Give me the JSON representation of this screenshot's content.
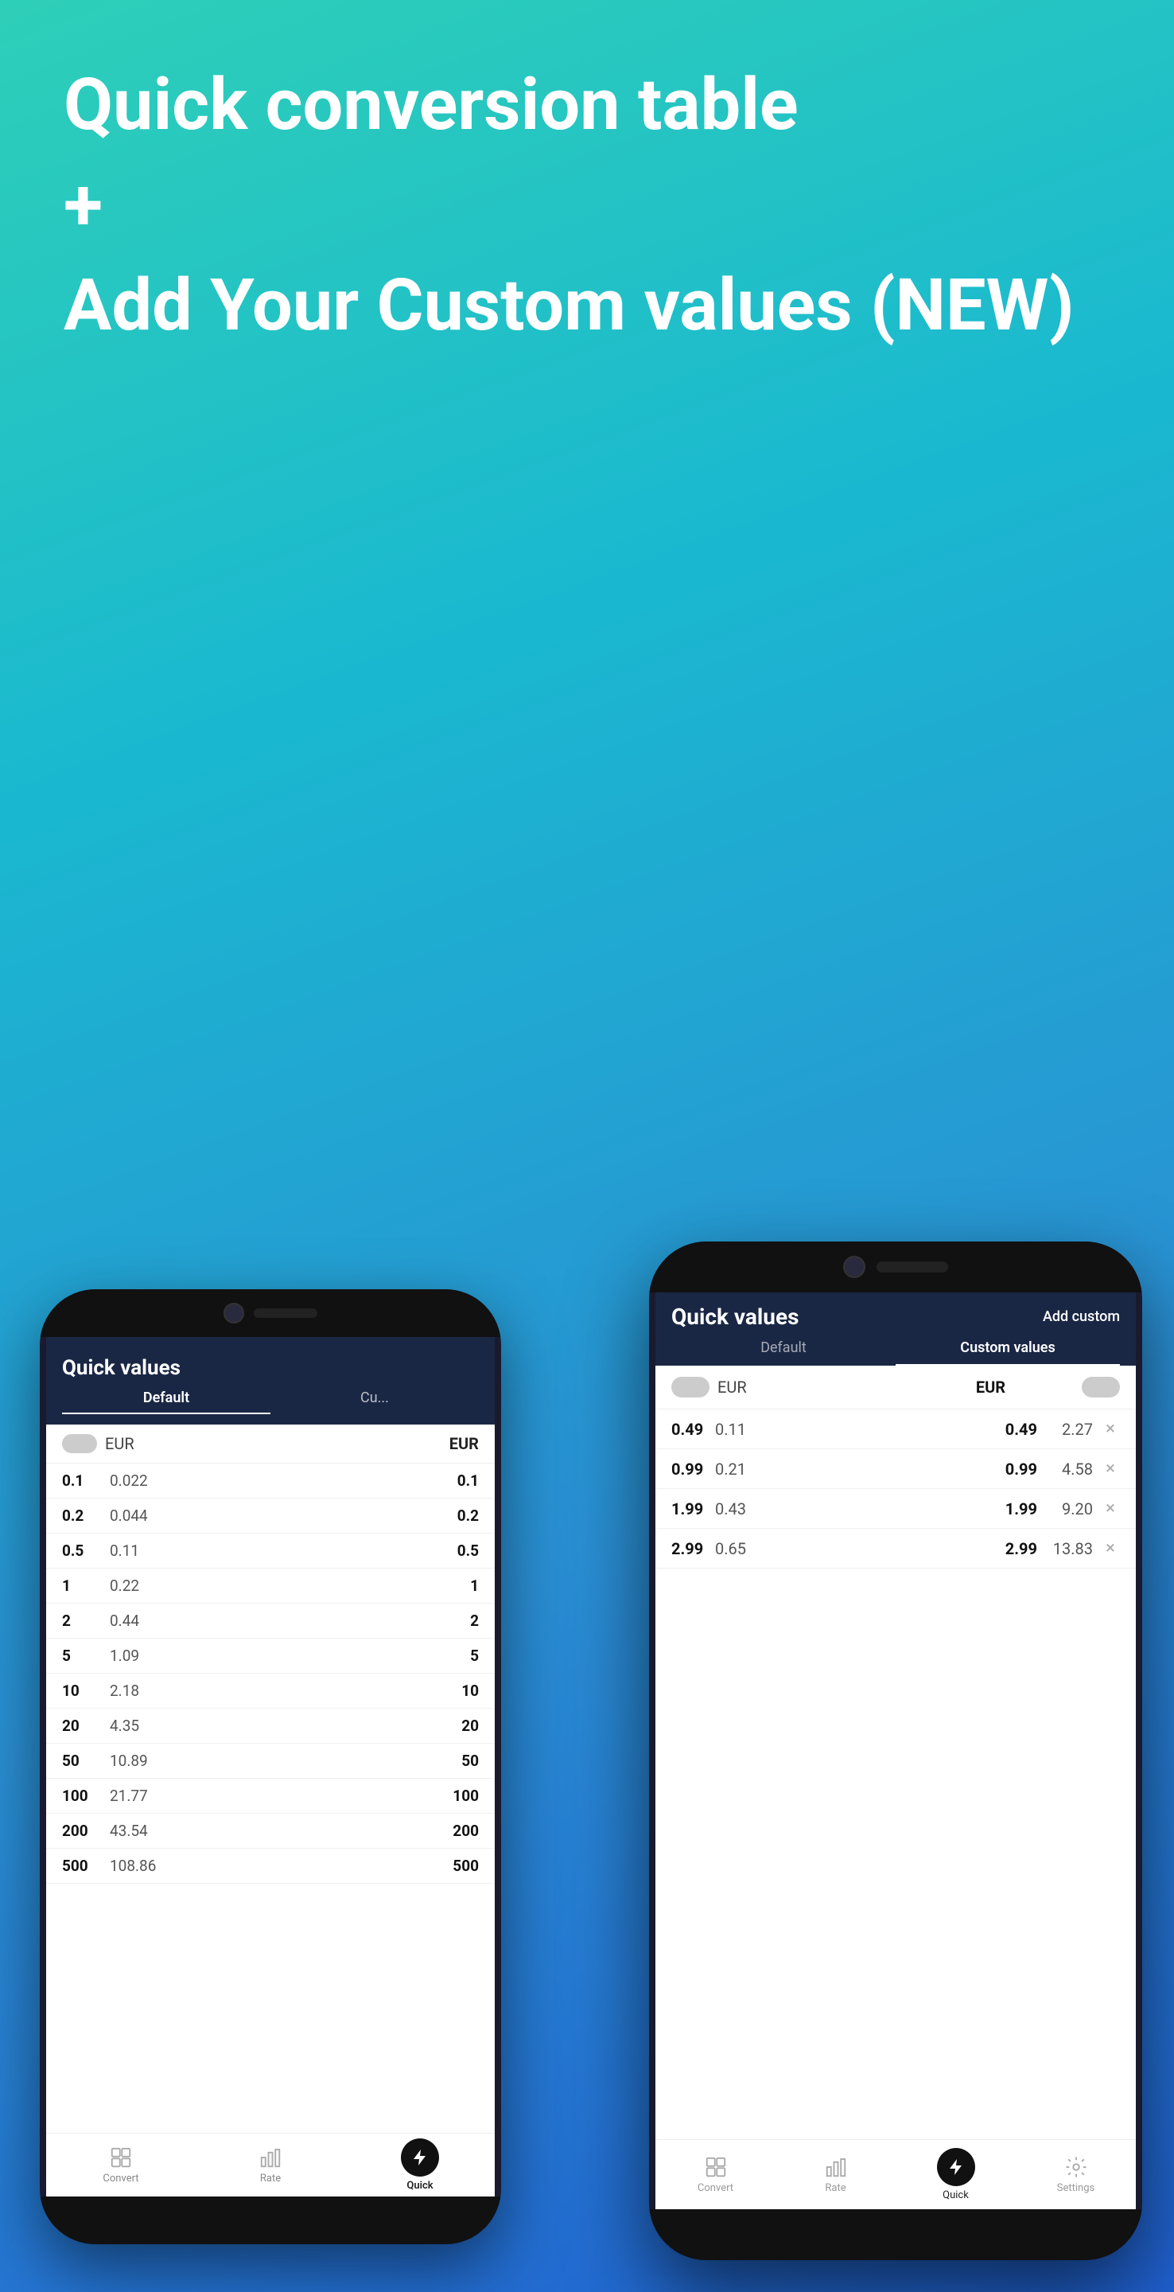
{
  "hero": {
    "title": "Quick conversion table",
    "plus": "+",
    "subtitle": "Add Your Custom values (NEW)"
  },
  "phone_back": {
    "title": "Quick values",
    "tabs": [
      {
        "label": "Default",
        "active": true
      },
      {
        "label": "Cu...",
        "active": false
      }
    ],
    "currency_left": "EUR",
    "currency_right": "EUR",
    "rows": [
      {
        "left_bold": "0.1",
        "left_val": "0.022",
        "right_bold": "0.1"
      },
      {
        "left_bold": "0.2",
        "left_val": "0.044",
        "right_bold": "0.2"
      },
      {
        "left_bold": "0.5",
        "left_val": "0.11",
        "right_bold": "0.5"
      },
      {
        "left_bold": "1",
        "left_val": "0.22",
        "right_bold": "1"
      },
      {
        "left_bold": "2",
        "left_val": "0.44",
        "right_bold": "2"
      },
      {
        "left_bold": "5",
        "left_val": "1.09",
        "right_bold": "5"
      },
      {
        "left_bold": "10",
        "left_val": "2.18",
        "right_bold": "10"
      },
      {
        "left_bold": "20",
        "left_val": "4.35",
        "right_bold": "20"
      },
      {
        "left_bold": "50",
        "left_val": "10.89",
        "right_bold": "50"
      },
      {
        "left_bold": "100",
        "left_val": "21.77",
        "right_bold": "100"
      },
      {
        "left_bold": "200",
        "left_val": "43.54",
        "right_bold": "200"
      },
      {
        "left_bold": "500",
        "left_val": "108.86",
        "right_bold": "500"
      }
    ],
    "nav": [
      {
        "label": "Convert",
        "icon": "grid-icon",
        "active": false
      },
      {
        "label": "Rate",
        "icon": "chart-icon",
        "active": false
      },
      {
        "label": "Quick",
        "icon": "bolt-icon",
        "active": true
      }
    ]
  },
  "phone_front": {
    "title": "Quick values",
    "add_custom": "Add custom",
    "tabs": [
      {
        "label": "Default",
        "active": false
      },
      {
        "label": "Custom values",
        "active": true
      }
    ],
    "currency_left": "EUR",
    "currency_right": "EUR",
    "custom_rows": [
      {
        "left_bold": "0.49",
        "left_val": "0.11",
        "right_bold": "0.49",
        "right_val": "2.27"
      },
      {
        "left_bold": "0.99",
        "left_val": "0.21",
        "right_bold": "0.99",
        "right_val": "4.58"
      },
      {
        "left_bold": "1.99",
        "left_val": "0.43",
        "right_bold": "1.99",
        "right_val": "9.20"
      },
      {
        "left_bold": "2.99",
        "left_val": "0.65",
        "right_bold": "2.99",
        "right_val": "13.83"
      }
    ],
    "nav": [
      {
        "label": "Convert",
        "icon": "grid-icon",
        "active": false
      },
      {
        "label": "Rate",
        "icon": "chart-icon",
        "active": false
      },
      {
        "label": "Quick",
        "icon": "bolt-icon",
        "active": true
      },
      {
        "label": "Settings",
        "icon": "gear-icon",
        "active": false
      }
    ]
  }
}
